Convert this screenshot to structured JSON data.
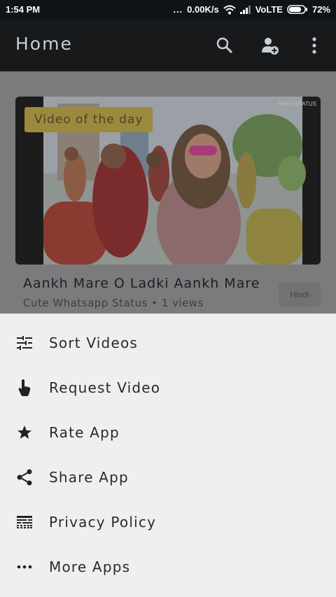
{
  "status_bar": {
    "time": "1:54 PM",
    "dots": "...",
    "speed": "0.00K/s",
    "network": "VoLTE",
    "battery": "72%"
  },
  "app_bar": {
    "title": "Home",
    "icons": [
      "search-icon",
      "add-user-icon",
      "more-vert-icon"
    ]
  },
  "featured": {
    "badge": "Video of the day",
    "watermark": "ANKH STATUS",
    "title": "Aankh Mare O Ladki Aankh Mare",
    "meta": "Cute Whatsapp Status • 1 views",
    "language": "Hindi"
  },
  "menu": {
    "items": [
      {
        "label": "Sort Videos",
        "icon": "sort-icon"
      },
      {
        "label": "Request Video",
        "icon": "touch-icon"
      },
      {
        "label": "Rate App",
        "icon": "star-icon"
      },
      {
        "label": "Share App",
        "icon": "share-icon"
      },
      {
        "label": "Privacy Policy",
        "icon": "policy-icon"
      },
      {
        "label": "More Apps",
        "icon": "more-horiz-icon"
      }
    ]
  },
  "colors": {
    "status_bar": "#0f1419",
    "app_bar": "#17191b",
    "scrim": "#7b7b7b",
    "sheet": "#efefef",
    "badge": "#9c8a3c"
  }
}
